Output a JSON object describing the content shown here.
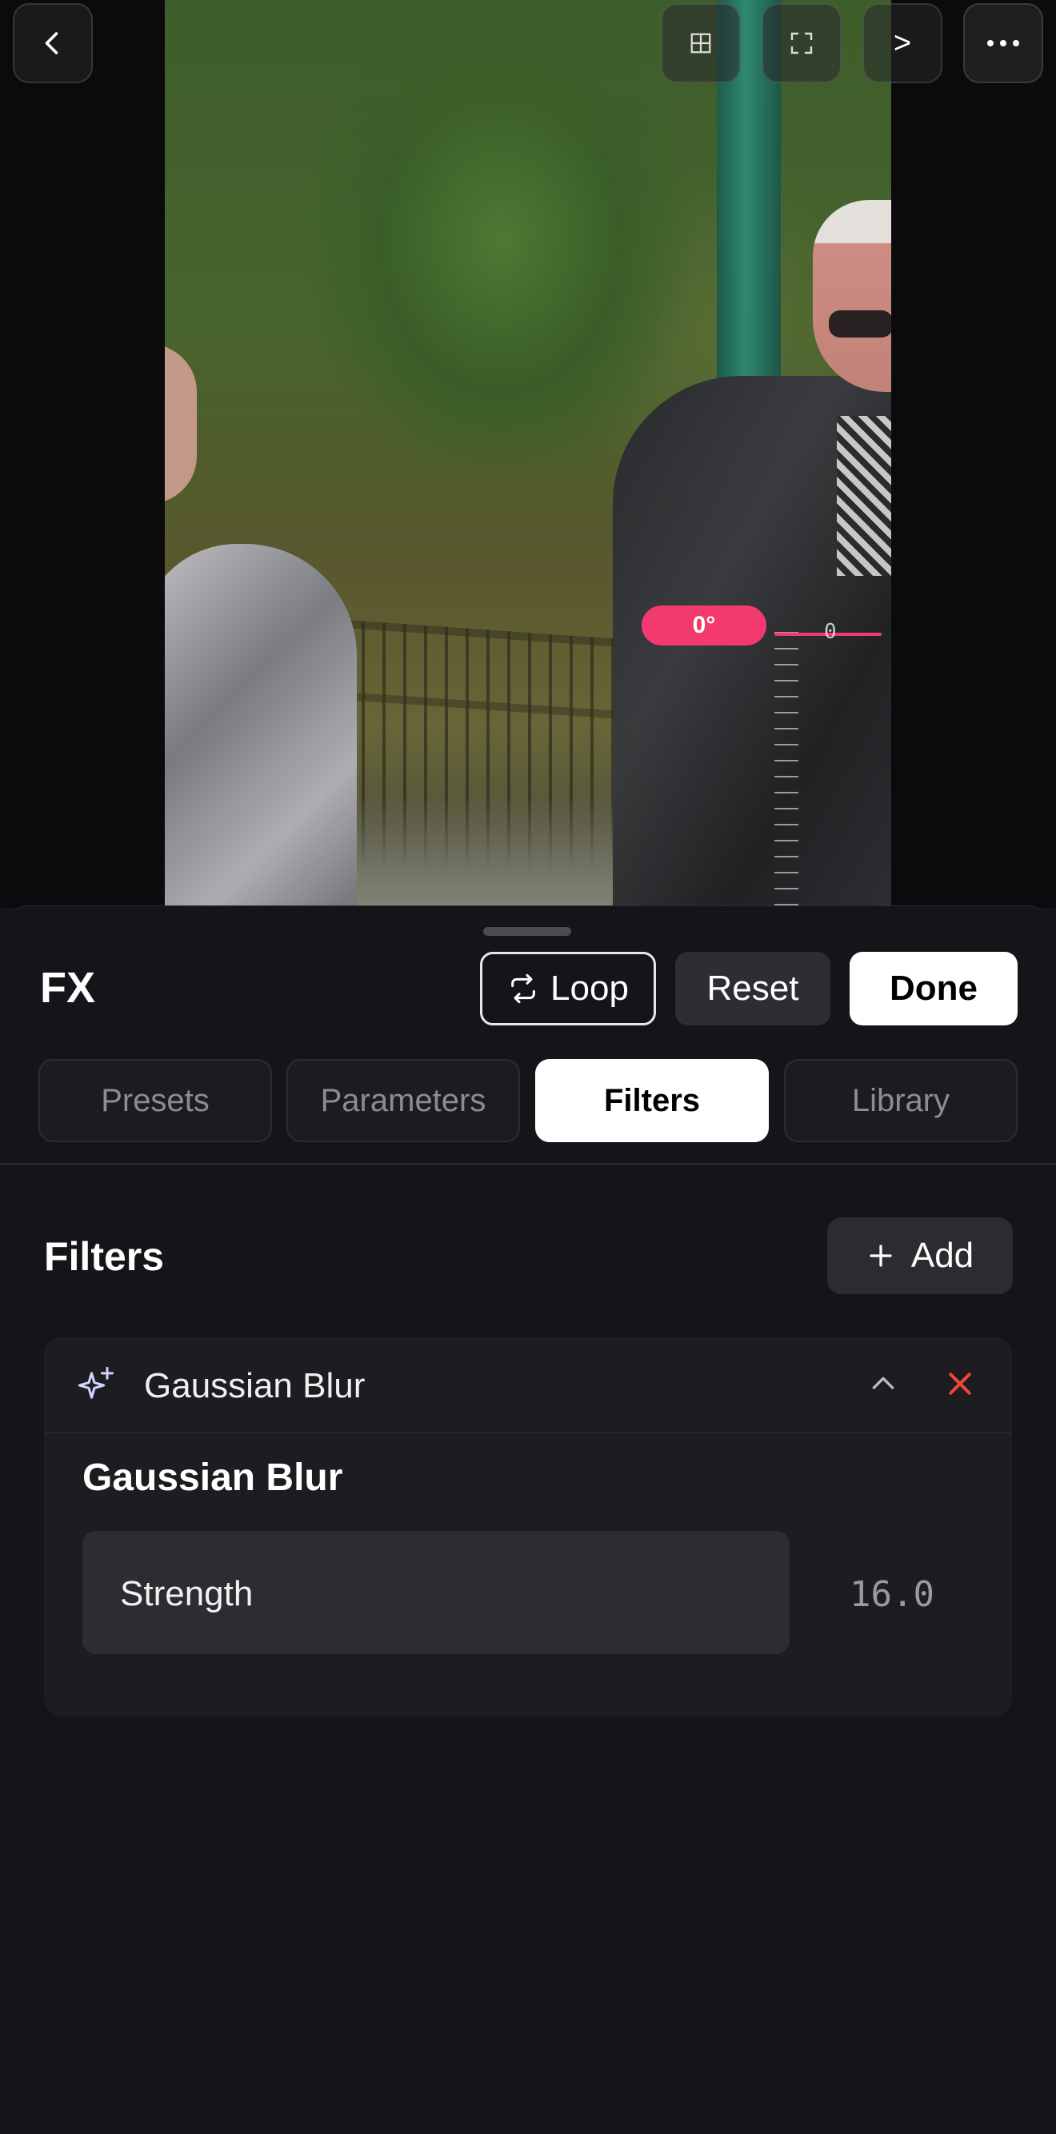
{
  "preview": {
    "angle_label": "0°",
    "ruler_zero": "0",
    "next_label": ">"
  },
  "toolbar": {
    "icons": [
      "back-chevron-icon",
      "grid-icon",
      "expand-icon",
      "next-icon",
      "more-icon"
    ]
  },
  "panel": {
    "title": "FX",
    "loop_label": "Loop",
    "reset_label": "Reset",
    "done_label": "Done",
    "tabs": [
      {
        "label": "Presets",
        "active": false
      },
      {
        "label": "Parameters",
        "active": false
      },
      {
        "label": "Filters",
        "active": true
      },
      {
        "label": "Library",
        "active": false
      }
    ],
    "section_title": "Filters",
    "add_label": "Add"
  },
  "filter_card": {
    "name": "Gaussian Blur",
    "detail_title": "Gaussian Blur",
    "param_label": "Strength",
    "param_value": "16.0",
    "accent_close": "#f0453a"
  },
  "colors": {
    "accent": "#f23a6e",
    "background": "#131318"
  }
}
